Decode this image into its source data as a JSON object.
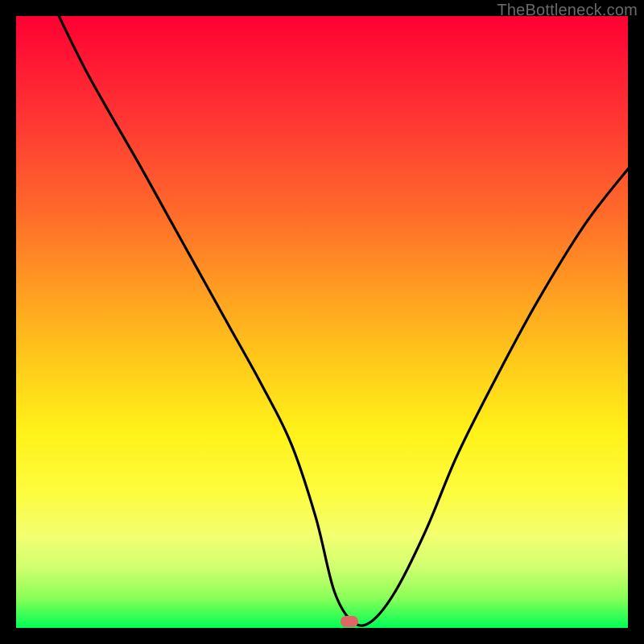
{
  "watermark": "TheBottleneck.com",
  "marker": {
    "x_pct": 54.5,
    "y_pct": 99.0,
    "color": "#e06666"
  },
  "chart_data": {
    "type": "line",
    "title": "",
    "xlabel": "",
    "ylabel": "",
    "xlim": [
      0,
      100
    ],
    "ylim": [
      0,
      100
    ],
    "grid": false,
    "series": [
      {
        "name": "bottleneck-curve",
        "x": [
          7,
          12,
          20,
          25,
          30,
          35,
          40,
          45,
          49,
          52,
          55,
          58,
          62,
          67,
          72,
          78,
          85,
          93,
          100
        ],
        "y": [
          100,
          90,
          76,
          67,
          58,
          49,
          40,
          30,
          18,
          6,
          1,
          1,
          6,
          16,
          28,
          40,
          53,
          66,
          75
        ]
      }
    ],
    "background_gradient": {
      "direction": "vertical",
      "stops": [
        {
          "pos": 0,
          "color": "#ff0033"
        },
        {
          "pos": 32,
          "color": "#ff6a2a"
        },
        {
          "pos": 56,
          "color": "#ffc81a"
        },
        {
          "pos": 78,
          "color": "#fdfc3f"
        },
        {
          "pos": 95,
          "color": "#8cff58"
        },
        {
          "pos": 100,
          "color": "#00ff55"
        }
      ]
    },
    "annotations": [
      {
        "type": "watermark",
        "text": "TheBottleneck.com",
        "position": "top-right"
      },
      {
        "type": "marker",
        "x": 54.5,
        "y": 1.0,
        "shape": "rounded-pill",
        "color": "#e06666"
      }
    ]
  }
}
